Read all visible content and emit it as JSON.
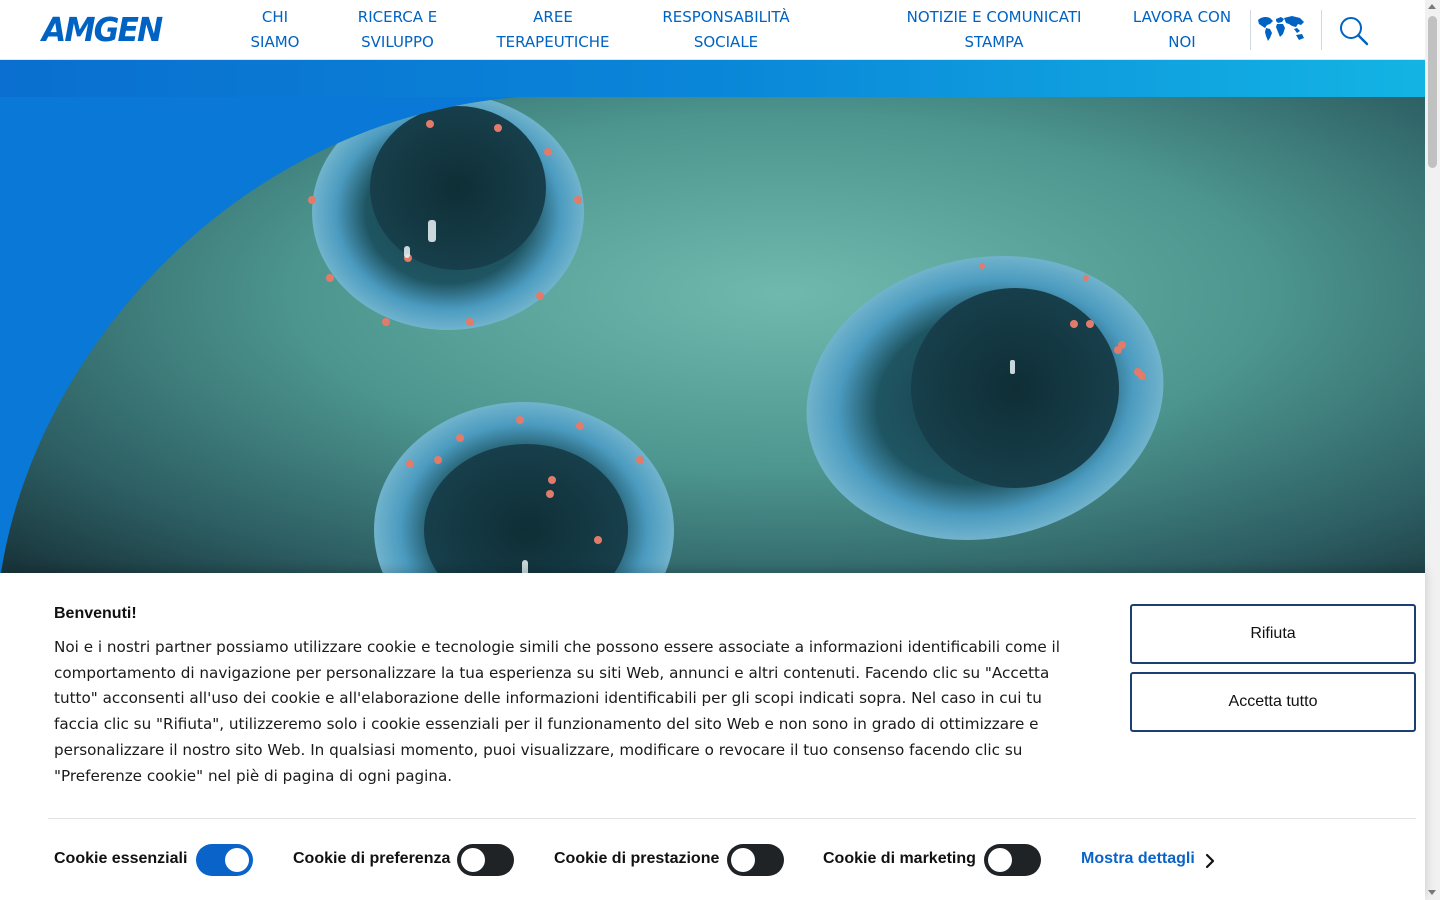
{
  "header": {
    "logo_text": "AMGEN",
    "brand_color": "#0063c3",
    "nav": [
      {
        "line1": "CHI",
        "line2": "SIAMO"
      },
      {
        "line1": "RICERCA E",
        "line2": "SVILUPPO"
      },
      {
        "line1": "AREE",
        "line2": "TERAPEUTICHE"
      },
      {
        "line1": "RESPONSABILITÀ",
        "line2": "SOCIALE"
      },
      {
        "line1": "NOTIZIE E COMUNICATI",
        "line2": "STAMPA"
      },
      {
        "line1": "LAVORA CON",
        "line2": "NOI"
      }
    ],
    "icons": [
      "world-map-icon",
      "search-icon"
    ]
  },
  "hero": {
    "accent_colors": [
      "#0a78d6",
      "#13b4e4"
    ]
  },
  "cookie_banner": {
    "title": "Benvenuti!",
    "text": "Noi e i nostri partner possiamo utilizzare cookie e tecnologie simili che possono essere associate a informazioni identificabili come il comportamento di navigazione per personalizzare la tua esperienza su siti Web, annunci e altri contenuti. Facendo clic su \"Accetta tutto\" acconsenti all'uso dei cookie e all'elaborazione delle informazioni identificabili per gli scopi indicati sopra. Nel caso in cui tu faccia clic su \"Rifiuta\", utilizzeremo solo i cookie essenziali per il funzionamento del sito Web e non sono in grado di ottimizzare e personalizzare il nostro sito Web. In qualsiasi momento, puoi visualizzare, modificare o revocare il tuo consenso facendo clic su \"Preferenze cookie\" nel piè di pagina di ogni pagina.",
    "reject_label": "Rifiuta",
    "accept_label": "Accetta tutto",
    "toggles": [
      {
        "label": "Cookie essenziali",
        "on": true
      },
      {
        "label": "Cookie di preferenza",
        "on": false
      },
      {
        "label": "Cookie di prestazione",
        "on": false
      },
      {
        "label": "Cookie di marketing",
        "on": false
      }
    ],
    "details_label": "Mostra dettagli",
    "toggle_on_color": "#0a63c8",
    "button_border_color": "#1b3f73"
  }
}
